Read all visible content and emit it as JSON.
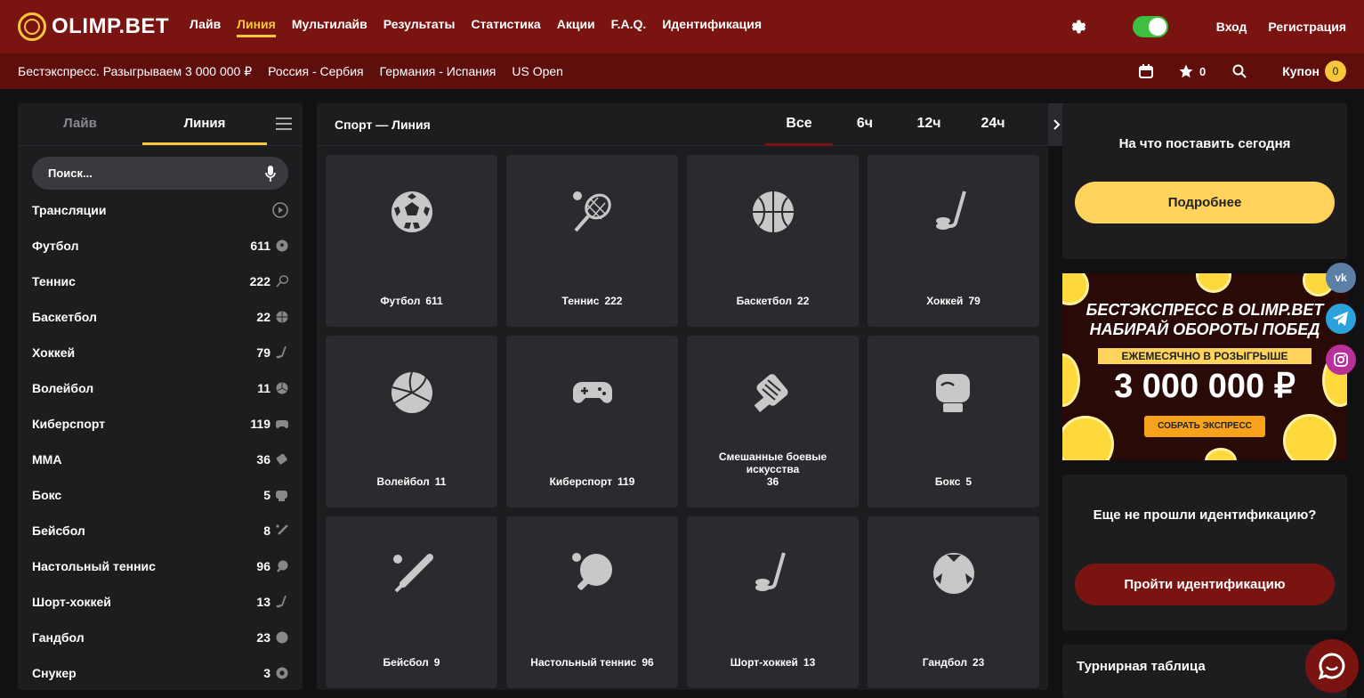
{
  "brand": {
    "name": "OLIMP.BET"
  },
  "nav": {
    "items": [
      "Лайв",
      "Линия",
      "Мультилайв",
      "Результаты",
      "Статистика",
      "Акции",
      "F.A.Q.",
      "Идентификация"
    ],
    "active": "Линия",
    "login": "Вход",
    "register": "Регистрация"
  },
  "promos": [
    "Бестэкспресс. Разыгрываем 3 000 000 ₽",
    "Россия - Сербия",
    "Германия - Испания",
    "US Open"
  ],
  "secbar": {
    "favorites_count": "0",
    "coupon_label": "Купон",
    "coupon_count": "0"
  },
  "sidebar": {
    "tabs": [
      "Лайв",
      "Линия"
    ],
    "active_tab": "Линия",
    "search_placeholder": "Поиск...",
    "broadcasts_label": "Трансляции",
    "sports": [
      {
        "name": "Футбол",
        "count": "611",
        "icon": "football-icon"
      },
      {
        "name": "Теннис",
        "count": "222",
        "icon": "tennis-icon"
      },
      {
        "name": "Баскетбол",
        "count": "22",
        "icon": "basketball-icon"
      },
      {
        "name": "Хоккей",
        "count": "79",
        "icon": "hockey-icon"
      },
      {
        "name": "Волейбол",
        "count": "11",
        "icon": "volleyball-icon"
      },
      {
        "name": "Киберспорт",
        "count": "119",
        "icon": "gamepad-icon"
      },
      {
        "name": "MMA",
        "count": "36",
        "icon": "glove-icon"
      },
      {
        "name": "Бокс",
        "count": "5",
        "icon": "boxing-icon"
      },
      {
        "name": "Бейсбол",
        "count": "8",
        "icon": "baseball-icon"
      },
      {
        "name": "Настольный теннис",
        "count": "96",
        "icon": "table-tennis-icon"
      },
      {
        "name": "Шорт-хоккей",
        "count": "13",
        "icon": "hockey-icon"
      },
      {
        "name": "Гандбол",
        "count": "23",
        "icon": "handball-icon"
      },
      {
        "name": "Снукер",
        "count": "3",
        "icon": "snooker-icon"
      }
    ]
  },
  "center": {
    "title": "Спорт — Линия",
    "filters": [
      "Все",
      "6ч",
      "12ч",
      "24ч"
    ],
    "active_filter": "Все",
    "tiles": [
      {
        "name": "Футбол",
        "count": "611",
        "icon": "football-icon"
      },
      {
        "name": "Теннис",
        "count": "222",
        "icon": "tennis-icon"
      },
      {
        "name": "Баскетбол",
        "count": "22",
        "icon": "basketball-icon"
      },
      {
        "name": "Хоккей",
        "count": "79",
        "icon": "hockey-icon"
      },
      {
        "name": "Волейбол",
        "count": "11",
        "icon": "volleyball-icon"
      },
      {
        "name": "Киберспорт",
        "count": "119",
        "icon": "gamepad-icon"
      },
      {
        "name": "Смешанные боевые искусства",
        "count": "36",
        "icon": "glove-icon"
      },
      {
        "name": "Бокс",
        "count": "5",
        "icon": "boxing-icon"
      },
      {
        "name": "Бейсбол",
        "count": "9",
        "icon": "baseball-icon"
      },
      {
        "name": "Настольный теннис",
        "count": "96",
        "icon": "table-tennis-icon"
      },
      {
        "name": "Шорт-хоккей",
        "count": "13",
        "icon": "hockey-icon"
      },
      {
        "name": "Гандбол",
        "count": "23",
        "icon": "handball-icon"
      }
    ]
  },
  "right": {
    "bet_today_title": "На что поставить сегодня",
    "more_button": "Подробнее",
    "banner_title_1": "БЕСТЭКСПРЕСС В OLIMP.BET",
    "banner_title_2": "НАБИРАЙ ОБОРОТЫ ПОБЕД",
    "banner_strip": "ЕЖЕМЕСЯЧНО В РОЗЫГРЫШЕ",
    "banner_amount": "3 000 000 ₽",
    "banner_button": "СОБРАТЬ ЭКСПРЕСС",
    "ident_title": "Еще не прошли идентификацию?",
    "ident_button": "Пройти идентификацию",
    "tournament_title": "Турнирная таблица"
  },
  "social": {
    "vk": "vk"
  },
  "colors": {
    "primary": "#7a1410",
    "accent": "#f7c83b",
    "button_yellow": "#ffd35c",
    "panel": "#1d1d20",
    "tile": "#2b2b2f"
  }
}
